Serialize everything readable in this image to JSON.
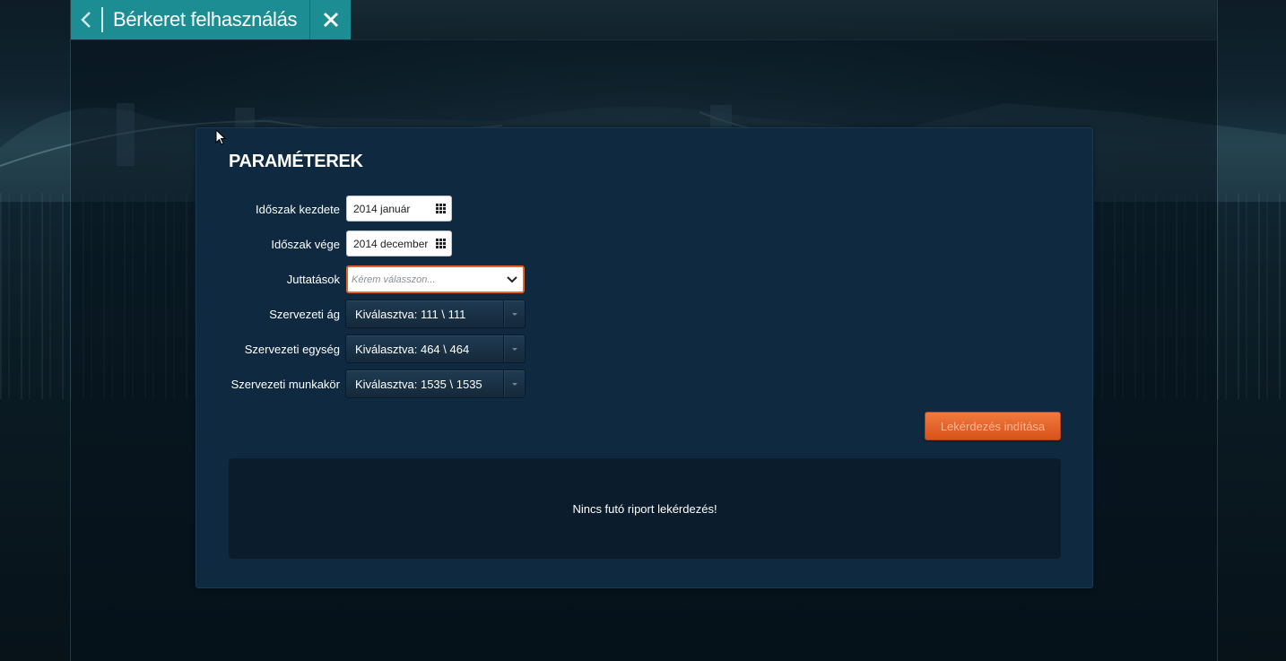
{
  "header": {
    "title": "Bérkeret felhasználás",
    "back_icon": "chevron-left-icon",
    "close_icon": "close-icon",
    "accent": "#1c8d93"
  },
  "panel": {
    "title": "PARAMÉTEREK",
    "fields": {
      "period_start": {
        "label": "Időszak kezdete",
        "value": "2014 január"
      },
      "period_end": {
        "label": "Időszak vége",
        "value": "2014 december"
      },
      "benefits": {
        "label": "Juttatások",
        "placeholder": "Kérem válasszon..."
      },
      "org_branch": {
        "label": "Szervezeti ág",
        "value": "Kiválasztva: 111 \\ 111"
      },
      "org_unit": {
        "label": "Szervezeti egység",
        "value": "Kiválasztva: 464 \\ 464"
      },
      "org_position": {
        "label": "Szervezeti munkakör",
        "value": "Kiválasztva: 1535 \\ 1535"
      }
    },
    "run_button": "Lekérdezés indítása",
    "status_message": "Nincs futó riport lekérdezés!"
  },
  "colors": {
    "panel_bg": "#0f2a40",
    "button_orange": "#e8622a",
    "focus_border": "#e8622a"
  }
}
